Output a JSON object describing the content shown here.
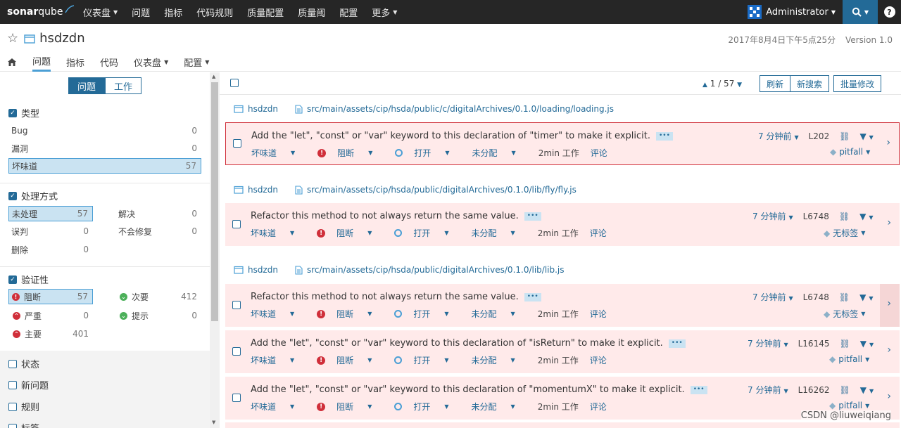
{
  "topnav": {
    "logo": {
      "a": "sonar",
      "b": "qube"
    },
    "items": [
      {
        "label": "仪表盘",
        "dropdown": true
      },
      {
        "label": "问题",
        "dropdown": false
      },
      {
        "label": "指标",
        "dropdown": false
      },
      {
        "label": "代码规则",
        "dropdown": false
      },
      {
        "label": "质量配置",
        "dropdown": false
      },
      {
        "label": "质量阈",
        "dropdown": false
      },
      {
        "label": "配置",
        "dropdown": false
      },
      {
        "label": "更多",
        "dropdown": true
      }
    ],
    "user": "Administrator",
    "help": "?"
  },
  "project": {
    "name": "hsdzdn",
    "date": "2017年8月4日下午5点25分",
    "version": "Version 1.0",
    "tabs": [
      "问题",
      "指标",
      "代码",
      "仪表盘",
      "配置"
    ],
    "active_tab": "问题"
  },
  "sidebar": {
    "mode_tabs": [
      "问题",
      "工作"
    ],
    "type": {
      "title": "类型",
      "items": [
        {
          "label": "Bug",
          "count": "0"
        },
        {
          "label": "漏洞",
          "count": "0"
        },
        {
          "label": "坏味道",
          "count": "57"
        }
      ]
    },
    "resolution": {
      "title": "处理方式",
      "items": [
        {
          "label": "未处理",
          "count": "57"
        },
        {
          "label": "解决",
          "count": "0"
        },
        {
          "label": "误判",
          "count": "0"
        },
        {
          "label": "不会修复",
          "count": "0"
        },
        {
          "label": "删除",
          "count": "0"
        }
      ]
    },
    "severity": {
      "title": "验证性",
      "items": [
        {
          "label": "阻断",
          "count": "57"
        },
        {
          "label": "次要",
          "count": "412"
        },
        {
          "label": "严重",
          "count": "0"
        },
        {
          "label": "提示",
          "count": "0"
        },
        {
          "label": "主要",
          "count": "401"
        }
      ]
    },
    "collapsed": [
      "状态",
      "新问题",
      "规则",
      "标签"
    ]
  },
  "toolbar": {
    "paging": "1 / 57",
    "refresh": "刷新",
    "new_search": "新搜索",
    "bulk_change": "批量修改"
  },
  "groups": [
    {
      "project": "hsdzdn",
      "path": "src/main/assets/cip/hsda/public/c/digitalArchives/0.1.0/loading/loading.js",
      "issues": [
        {
          "message": "Add the \"let\", \"const\" or \"var\" keyword to this declaration of \"timer\" to make it explicit.",
          "type": "坏味道",
          "severity": "阻断",
          "status": "打开",
          "assignee": "未分配",
          "effort": "2min 工作",
          "comment": "评论",
          "ago": "7 分钟前",
          "line": "L202",
          "tag": "pitfall"
        }
      ]
    },
    {
      "project": "hsdzdn",
      "path": "src/main/assets/cip/hsda/public/digitalArchives/0.1.0/lib/fly/fly.js",
      "issues": [
        {
          "message": "Refactor this method to not always return the same value.",
          "type": "坏味道",
          "severity": "阻断",
          "status": "打开",
          "assignee": "未分配",
          "effort": "2min 工作",
          "comment": "评论",
          "ago": "7 分钟前",
          "line": "L6748",
          "tag": "无标签"
        }
      ]
    },
    {
      "project": "hsdzdn",
      "path": "src/main/assets/cip/hsda/public/digitalArchives/0.1.0/lib/lib.js",
      "issues": [
        {
          "message": "Refactor this method to not always return the same value.",
          "type": "坏味道",
          "severity": "阻断",
          "status": "打开",
          "assignee": "未分配",
          "effort": "2min 工作",
          "comment": "评论",
          "ago": "7 分钟前",
          "line": "L6748",
          "tag": "无标签"
        },
        {
          "message": "Add the \"let\", \"const\" or \"var\" keyword to this declaration of \"isReturn\" to make it explicit.",
          "type": "坏味道",
          "severity": "阻断",
          "status": "打开",
          "assignee": "未分配",
          "effort": "2min 工作",
          "comment": "评论",
          "ago": "7 分钟前",
          "line": "L16145",
          "tag": "pitfall"
        },
        {
          "message": "Add the \"let\", \"const\" or \"var\" keyword to this declaration of \"momentumX\" to make it explicit.",
          "type": "坏味道",
          "severity": "阻断",
          "status": "打开",
          "assignee": "未分配",
          "effort": "2min 工作",
          "comment": "评论",
          "ago": "7 分钟前",
          "line": "L16262",
          "tag": "pitfall"
        }
      ]
    }
  ],
  "watermark": "CSDN @liuweiqiang",
  "colors": {
    "accent": "#236a97",
    "blocker": "#d02f3a",
    "issue_bg": "#ffeaea",
    "topnav": "#262626"
  }
}
